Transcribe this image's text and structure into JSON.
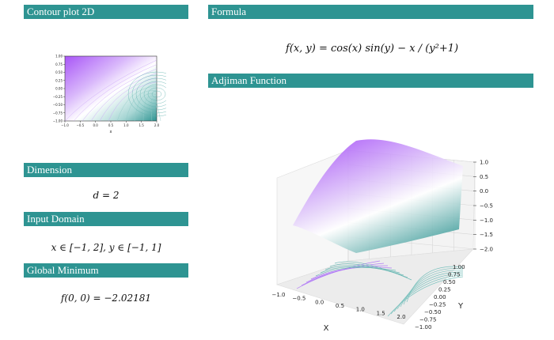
{
  "sections": {
    "contour": {
      "title": "Contour plot 2D"
    },
    "formula": {
      "title": "Formula",
      "expression": "f(x, y) = cos(x) sin(y) − x / (y²+1)"
    },
    "adjiman": {
      "title": "Adjiman Function"
    },
    "dimension": {
      "title": "Dimension",
      "value": "d = 2"
    },
    "input_domain": {
      "title": "Input Domain",
      "value": "x ∈ [−1, 2], y ∈ [−1, 1]"
    },
    "global_minimum": {
      "title": "Global Minimum",
      "value": "f(0, 0) = −2.02181"
    }
  },
  "chart_data": [
    {
      "type": "contour",
      "xlabel": "x",
      "ylabel": "",
      "xlim": [
        -1.0,
        2.0
      ],
      "ylim": [
        -1.0,
        1.0
      ],
      "xticks": [
        "−1.0",
        "−0.5",
        "0.0",
        "0.5",
        "1.0",
        "1.5",
        "2.0"
      ],
      "yticks": [
        "1.00",
        "0.75",
        "0.50",
        "0.25",
        "0.00",
        "−0.25",
        "−0.50",
        "−0.75",
        "−1.00"
      ],
      "colormap": [
        "#a855f7",
        "#ffffff",
        "#2e9492"
      ]
    },
    {
      "type": "surface3d",
      "xlabel": "X",
      "ylabel": "Y",
      "xlim": [
        -1.0,
        2.0
      ],
      "ylim": [
        -1.0,
        1.0
      ],
      "zlim": [
        -2.0,
        1.0
      ],
      "xticks": [
        "−1.0",
        "−0.5",
        "0.0",
        "0.5",
        "1.0",
        "1.5",
        "2.0"
      ],
      "yticks": [
        "1.00",
        "0.75",
        "0.50",
        "0.25",
        "0.00",
        "−0.25",
        "−0.50",
        "−0.75",
        "−1.00"
      ],
      "zticks": [
        "1.0",
        "0.5",
        "0.0",
        "−0.5",
        "−1.0",
        "−1.5",
        "−2.0"
      ],
      "colormap": [
        "#a855f7",
        "#ffffff",
        "#2e9492"
      ]
    }
  ]
}
